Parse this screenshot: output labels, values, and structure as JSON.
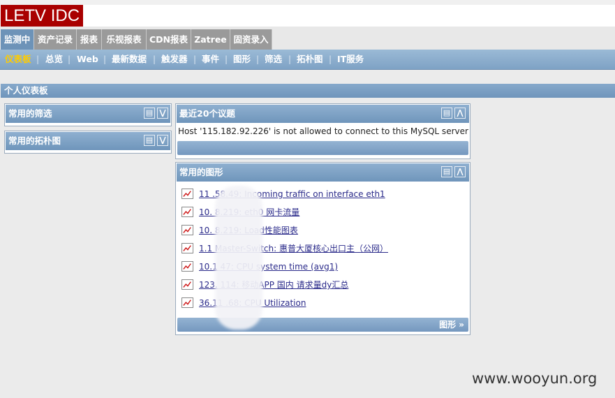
{
  "brand": {
    "logo": "LETV IDC"
  },
  "main_menu": [
    {
      "label": "监测中",
      "active": true
    },
    {
      "label": "资产记录"
    },
    {
      "label": "报表"
    },
    {
      "label": "乐视报表"
    },
    {
      "label": "CDN报表"
    },
    {
      "label": "Zatree"
    },
    {
      "label": "固资录入"
    }
  ],
  "sub_menu": [
    {
      "label": "仪表板",
      "active": true
    },
    {
      "label": "总览"
    },
    {
      "label": "Web"
    },
    {
      "label": "最新数据"
    },
    {
      "label": "触发器"
    },
    {
      "label": "事件"
    },
    {
      "label": "图形"
    },
    {
      "label": "筛选"
    },
    {
      "label": "拓朴图"
    },
    {
      "label": "IT服务"
    }
  ],
  "page_title": "个人仪表板",
  "widgets": {
    "favorite_filters": {
      "title": "常用的筛选"
    },
    "favorite_maps": {
      "title": "常用的拓朴图"
    },
    "last_issues": {
      "title": "最近20个议题",
      "message": "Host '115.182.92.226' is not allowed to connect to this MySQL server"
    },
    "favorite_graphs": {
      "title": "常用的图形",
      "items": [
        "11        .58.49: Incoming traffic on interface eth1",
        "10.        8.219: eth0 网卡流量",
        "10.        8.219: Load性能图表",
        "1.1        Master-Switch: 惠普大厦核心出口主（公网）",
        "10.1        47: CPU system time (avg1)",
        "123.        114: 移动APP 国内 请求量dy汇总",
        "36.11        .68: CPU Utilization"
      ],
      "footer_link": "图形 »"
    }
  },
  "icons": {
    "list": "list-icon",
    "collapse": "chevron-up-icon",
    "expand": "chevron-down-icon",
    "graph": "line-graph-icon"
  },
  "watermark": "www.wooyun.org",
  "colors": {
    "logo_bg": "#a90000",
    "header_blue": "#7ea2c5",
    "active_sub": "#ffcc00"
  }
}
